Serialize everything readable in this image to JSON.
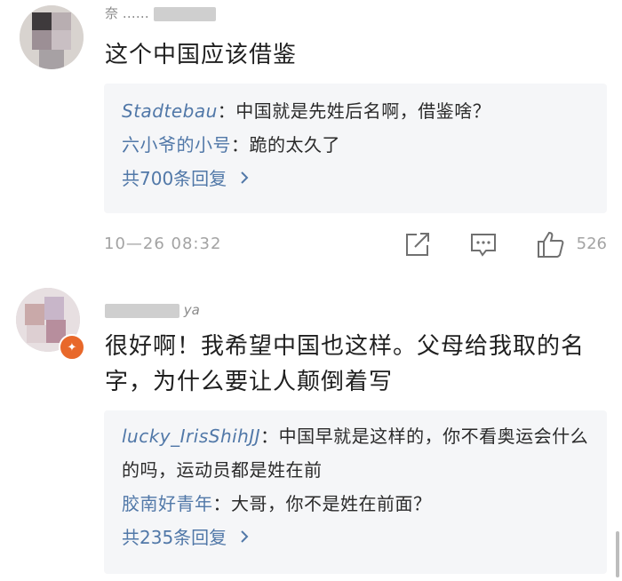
{
  "comments": [
    {
      "username": "奈 ……",
      "text": "这个中国应该借鉴",
      "replies": [
        {
          "name": "Stadtebau",
          "text": "：中国就是先姓后名啊，借鉴啥？"
        },
        {
          "name": "六小爷的小号",
          "text": "：跪的太久了"
        }
      ],
      "more_replies": "共700条回复",
      "time": "10—26 08:32",
      "likes": "526"
    },
    {
      "username": "ya",
      "text": "很好啊！我希望中国也这样。父母给我取的名字，为什么要让人颠倒着写",
      "replies": [
        {
          "name": "lucky_IrisShihJJ",
          "text": "：中国早就是这样的，你不看奥运会什么的吗，运动员都是姓在前"
        },
        {
          "name": "胶南好青年",
          "text": "：大哥，你不是姓在前面？"
        }
      ],
      "more_replies": "共235条回复"
    }
  ],
  "icons": {
    "share": "share-icon",
    "comment": "comment-icon",
    "like": "thumbs-up-icon",
    "chevron": "chevron-right-icon",
    "verified": "verified-badge-icon"
  },
  "colors": {
    "link": "#5178a8",
    "reply_bg": "#f5f6f8",
    "meta": "#a3a3a3",
    "badge": "#e8682a"
  }
}
